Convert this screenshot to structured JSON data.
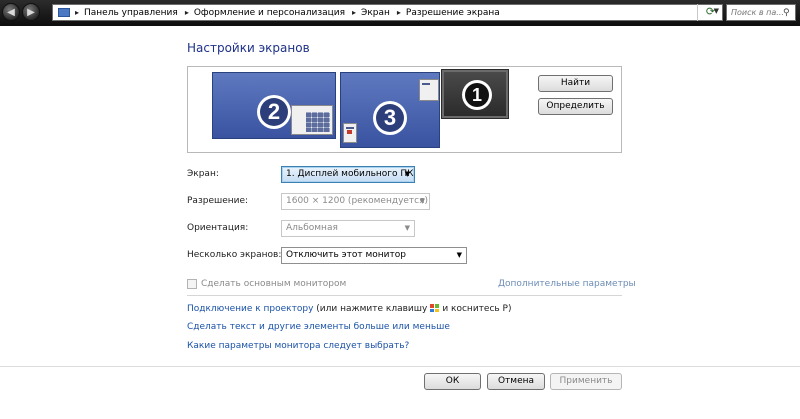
{
  "address_bar": {
    "breadcrumbs": [
      "Панель управления",
      "Оформление и персонализация",
      "Экран",
      "Разрешение экрана"
    ],
    "search_placeholder": "Поиск в па..."
  },
  "page": {
    "title": "Настройки экранов"
  },
  "monitors": [
    {
      "number": "2",
      "active": false
    },
    {
      "number": "3",
      "active": false
    },
    {
      "number": "1",
      "active": true
    }
  ],
  "buttons": {
    "find": "Найти",
    "identify": "Определить",
    "ok": "ОК",
    "cancel": "Отмена",
    "apply": "Применить"
  },
  "settings": {
    "screen_label": "Экран:",
    "screen_value": "1. Дисплей мобильного ПК",
    "resolution_label": "Разрешение:",
    "resolution_value": "1600 × 1200 (рекомендуется)",
    "orientation_label": "Ориентация:",
    "orientation_value": "Альбомная",
    "multi_label": "Несколько экранов:",
    "multi_value": "Отключить этот монитор"
  },
  "primary_checkbox": {
    "label": "Сделать основным монитором",
    "checked": false
  },
  "links": {
    "advanced": "Дополнительные параметры",
    "projector": "Подключение к проектору",
    "projector_hint_before": "(или нажмите клавишу",
    "projector_hint_after": "и коснитесь P)",
    "text_size": "Сделать текст и другие элементы больше или меньше",
    "which_settings": "Какие параметры монитора следует выбрать?"
  },
  "colors": {
    "title": "#1e3287",
    "link": "#1a52a8",
    "monitor_blue": "#4a64b0",
    "monitor_selected": "#2b2b2b"
  }
}
